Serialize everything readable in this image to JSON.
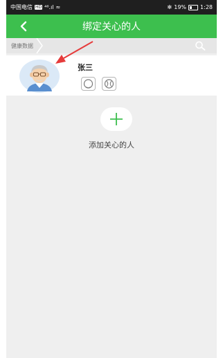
{
  "status_bar": {
    "carrier": "中国电信",
    "hd_badge": "HD",
    "signal": "⁴⁶.ıl",
    "wifi": "≈",
    "bt_badge": "✻",
    "battery_percent": "19%",
    "time": "1:28"
  },
  "header": {
    "title": "绑定关心的人"
  },
  "breadcrumb": {
    "label": "健康数据"
  },
  "person": {
    "name": "张三",
    "devices": [
      "watch-icon",
      "ball-icon"
    ]
  },
  "add": {
    "label": "添加关心的人"
  },
  "colors": {
    "accent": "#3dbf4e",
    "annotation": "#e63b3b"
  }
}
